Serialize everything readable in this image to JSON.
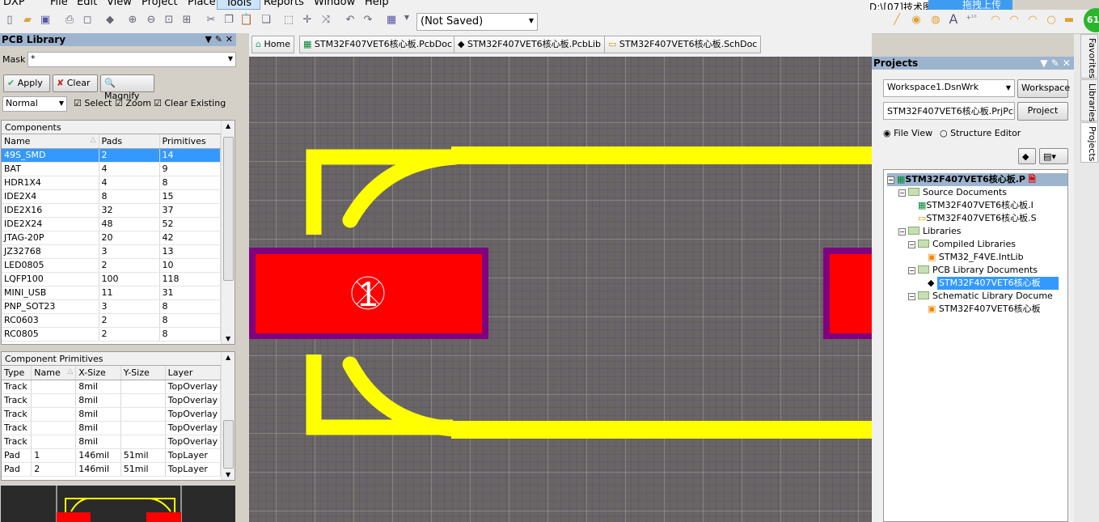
{
  "menu": [
    "DXP",
    "File",
    "Edit",
    "View",
    "Project",
    "Place",
    "Tools",
    "Reports",
    "Window",
    "Help"
  ],
  "toolbar": {
    "layer_combo": "(Not Saved)",
    "path": "D:\\[07]技术图",
    "upload_label": "拖拽上传",
    "badge": "61"
  },
  "doc_tabs": [
    "Home",
    "STM32F407VET6核心板.PcbDoc",
    "STM32F407VET6核心板.PcbLib",
    "STM32F407VET6核心板.SchDoc"
  ],
  "pcb_library": {
    "title": "PCB Library",
    "mask_label": "Mask",
    "mask_value": "*",
    "apply": "Apply",
    "clear": "Clear",
    "magnify": "Magnify",
    "mode": "Normal",
    "select": "Select",
    "zoom": "Zoom",
    "clear_existing": "Clear Existing",
    "components": {
      "title": "Components",
      "columns": [
        "Name",
        "Pads",
        "Primitives"
      ],
      "rows": [
        [
          "49S_SMD",
          "2",
          "14"
        ],
        [
          "BAT",
          "4",
          "9"
        ],
        [
          "HDR1X4",
          "4",
          "8"
        ],
        [
          "IDE2X4",
          "8",
          "15"
        ],
        [
          "IDE2X16",
          "32",
          "37"
        ],
        [
          "IDE2X24",
          "48",
          "52"
        ],
        [
          "JTAG-20P",
          "20",
          "42"
        ],
        [
          "JZ32768",
          "3",
          "13"
        ],
        [
          "LED0805",
          "2",
          "10"
        ],
        [
          "LQFP100",
          "100",
          "118"
        ],
        [
          "MINI_USB",
          "11",
          "31"
        ],
        [
          "PNP_SOT23",
          "3",
          "8"
        ],
        [
          "RC0603",
          "2",
          "8"
        ],
        [
          "RC0805",
          "2",
          "8"
        ]
      ]
    },
    "primitives": {
      "title": "Component Primitives",
      "columns": [
        "Type",
        "Name",
        "X-Size",
        "Y-Size",
        "Layer"
      ],
      "rows": [
        [
          "Track",
          "",
          "8mil",
          "",
          "TopOverlay"
        ],
        [
          "Track",
          "",
          "8mil",
          "",
          "TopOverlay"
        ],
        [
          "Track",
          "",
          "8mil",
          "",
          "TopOverlay"
        ],
        [
          "Track",
          "",
          "8mil",
          "",
          "TopOverlay"
        ],
        [
          "Track",
          "",
          "8mil",
          "",
          "TopOverlay"
        ],
        [
          "Pad",
          "1",
          "146mil",
          "51mil",
          "TopLayer"
        ],
        [
          "Pad",
          "2",
          "146mil",
          "51mil",
          "TopLayer"
        ]
      ]
    }
  },
  "canvas": {
    "pad_label": "1",
    "colors": {
      "background": "#6a6565",
      "track": "#ffff00",
      "pad": "#ff0000",
      "pad_border": "#800080"
    }
  },
  "projects": {
    "title": "Projects",
    "workspace": "Workspace1.DsnWrk",
    "workspace_btn": "Workspace",
    "project": "STM32F407VET6核心板.PrjPcb",
    "project_btn": "Project",
    "file_view": "File View",
    "structure_editor": "Structure Editor",
    "tree": [
      "STM32F407VET6核心板.P",
      "Source Documents",
      "STM32F407VET6核心板.I",
      "STM32F407VET6核心板.S",
      "Libraries",
      "Compiled Libraries",
      "STM32_F4VE.IntLib",
      "PCB Library Documents",
      "STM32F407VET6核心板",
      "Schematic Library Docume",
      "STM32F407VET6核心板"
    ]
  },
  "side_tabs": [
    "Favorites",
    "Libraries",
    "Projects"
  ]
}
